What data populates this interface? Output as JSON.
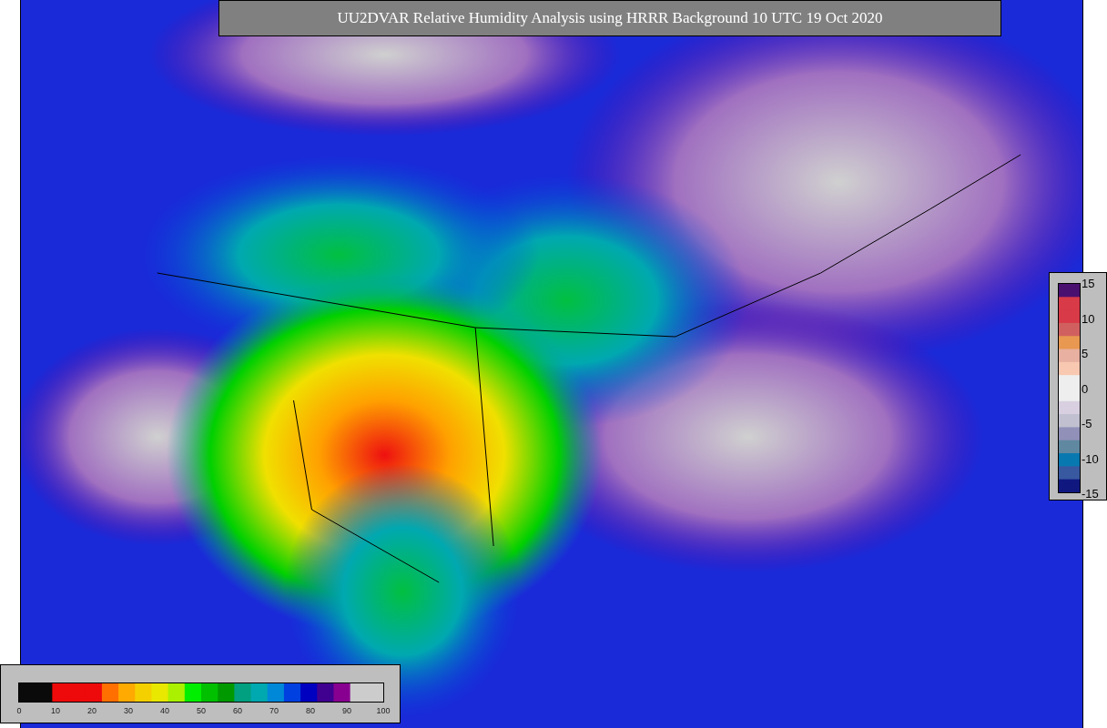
{
  "title": "UU2DVAR Relative Humidity Analysis using HRRR Background 10 UTC 19 Oct 2020",
  "humidity_colorbar": {
    "ticks": [
      "0",
      "10",
      "20",
      "30",
      "40",
      "50",
      "60",
      "70",
      "80",
      "90",
      "100"
    ]
  },
  "increment_colorbar": {
    "ticks": [
      "15",
      "10",
      "5",
      "0",
      "-5",
      "-10",
      "-15"
    ]
  }
}
